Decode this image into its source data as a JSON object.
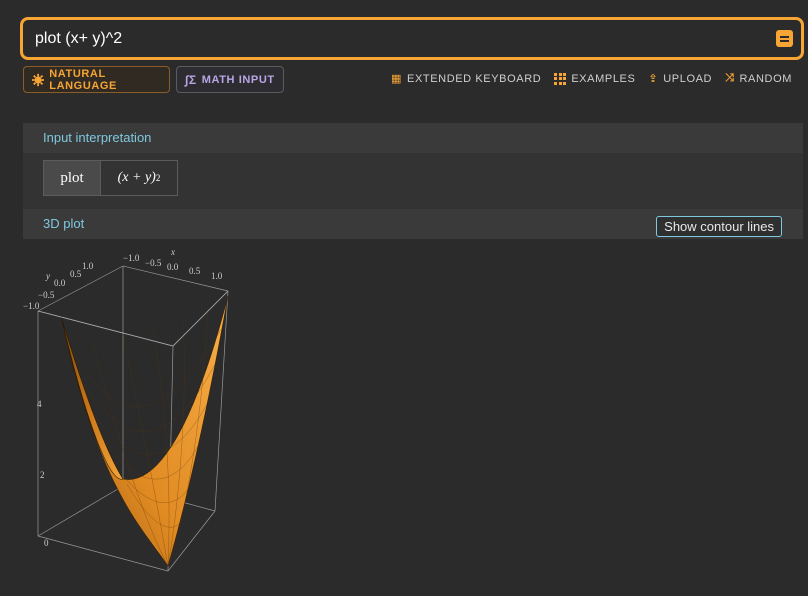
{
  "search": {
    "value": "plot (x+ y)^2",
    "submit_icon": "equals-icon"
  },
  "modes": {
    "natural_language": {
      "label": "NATURAL LANGUAGE",
      "icon": "sun-gear-icon"
    },
    "math_input": {
      "label": "MATH INPUT",
      "icon": "sigma-icon"
    }
  },
  "toolbar": {
    "extended_keyboard": "EXTENDED KEYBOARD",
    "examples": "EXAMPLES",
    "upload": "UPLOAD",
    "random": "RANDOM"
  },
  "pods": {
    "input_interpretation": {
      "title": "Input interpretation",
      "function": "plot",
      "expression": "(x + y)",
      "exponent": "2"
    },
    "plot3d": {
      "title": "3D plot",
      "contour_button": "Show contour lines",
      "axes": {
        "x_label": "x",
        "y_label": "y",
        "x_ticks": [
          "−1.0",
          "−0.5",
          "0.0",
          "0.5",
          "1.0"
        ],
        "y_ticks": [
          "1.0",
          "0.5",
          "0.0",
          "−0.5",
          "−1.0"
        ],
        "z_ticks": [
          "0",
          "2",
          "4"
        ]
      }
    }
  },
  "colors": {
    "accent": "#f7a535",
    "math": "#b9a6e6",
    "pod_title": "#7fc9e0",
    "surface": "#f29a26"
  }
}
